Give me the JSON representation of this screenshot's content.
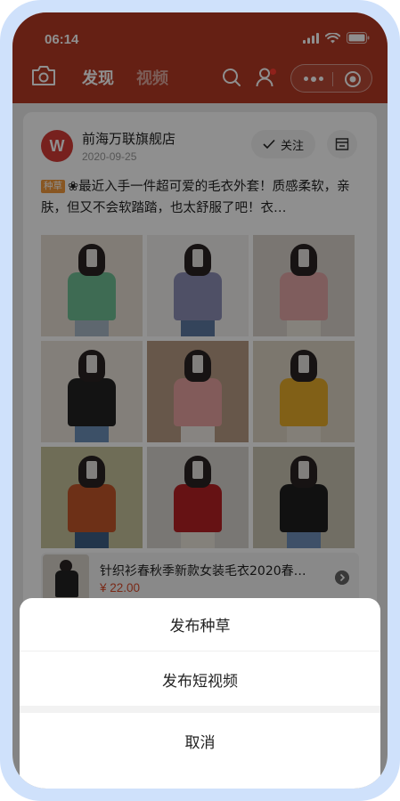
{
  "status_bar": {
    "time": "06:14"
  },
  "header": {
    "tabs": [
      {
        "label": "发现",
        "active": true
      },
      {
        "label": "视频",
        "active": false
      }
    ]
  },
  "post": {
    "store_name": "前海万联旗舰店",
    "avatar_letter": "W",
    "date": "2020-09-25",
    "follow_label": "关注",
    "tag": "种草",
    "description": "❀最近入手一件超可爱的毛衣外套！质感柔软，亲肤，但又不会软踏踏，也太舒服了吧！衣…",
    "photos": [
      {
        "top": "#6fbf95",
        "bottom": "#a8b8c7",
        "bg": "#e6ddd2"
      },
      {
        "top": "#8e8fb6",
        "bottom": "#5e79a3",
        "bg": "#f1efed"
      },
      {
        "top": "#e3a7a7",
        "bottom": "#ede8dd",
        "bg": "#d9d2cc"
      },
      {
        "top": "#222222",
        "bottom": "#6c8fb8",
        "bg": "#e9e3da"
      },
      {
        "top": "#e8a3a0",
        "bottom": "#f0ece6",
        "bg": "#b89c84"
      },
      {
        "top": "#e7ac2a",
        "bottom": "#e9e2d6",
        "bg": "#ddd4c5"
      },
      {
        "top": "#c2562a",
        "bottom": "#3e5f86",
        "bg": "#c7c29b"
      },
      {
        "top": "#b62025",
        "bottom": "#ece7dc",
        "bg": "#d8d4cf"
      },
      {
        "top": "#1f1f1f",
        "bottom": "#6f8fba",
        "bg": "#c9c5b3"
      }
    ]
  },
  "product": {
    "title": "针织衫春秋季新款女装毛衣2020春…",
    "price": "¥ 22.00"
  },
  "action_sheet": {
    "option_1": "发布种草",
    "option_2": "发布短视频",
    "cancel": "取消"
  },
  "colors": {
    "brand_red": "#b53a25",
    "price_red": "#d94b2b",
    "tag_orange": "#f39a3e"
  }
}
